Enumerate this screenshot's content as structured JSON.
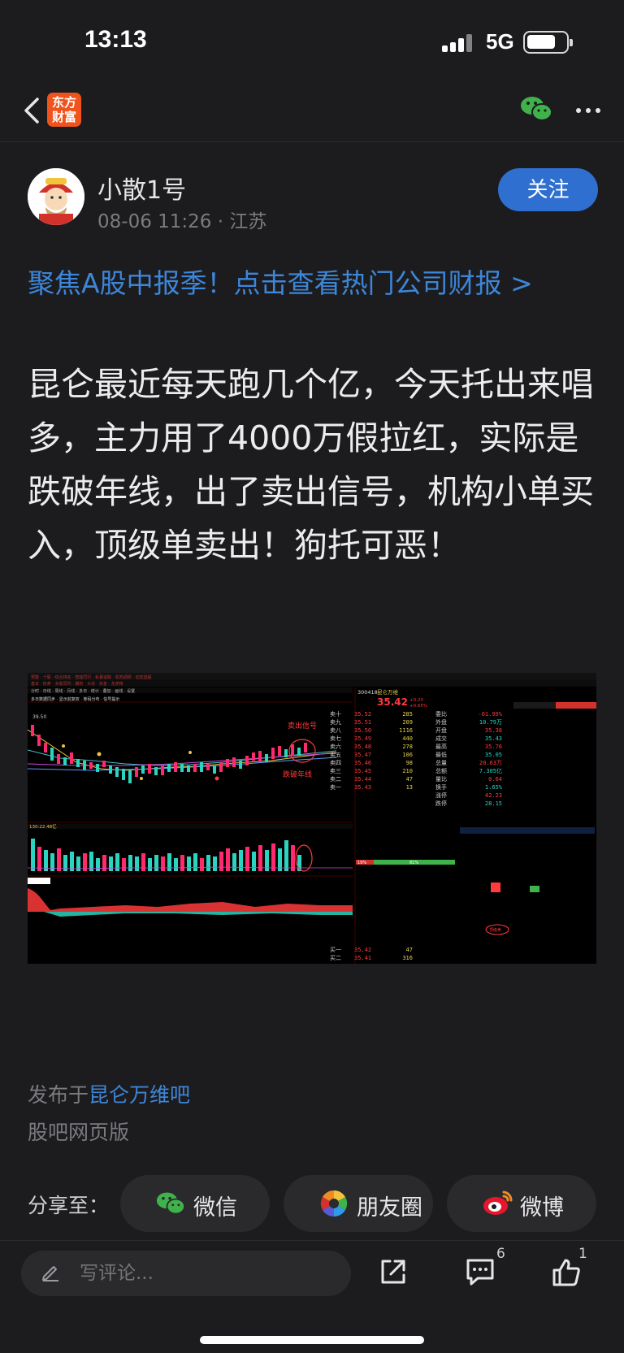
{
  "status": {
    "time": "13:13",
    "network": "5G"
  },
  "nav": {
    "logo_line1": "东方",
    "logo_line2": "财富"
  },
  "author": {
    "name": "小散1号",
    "meta": "08-06 11:26 · 江苏",
    "follow_label": "关注"
  },
  "promo": {
    "text": "聚焦A股中报季！点击查看热门公司财报 >"
  },
  "post": {
    "body": "昆仑最近每天跑几个亿，今天托出来唱多，主力用了4000万假拉红，实际是跌破年线，出了卖出信号，机构小单买入，顶级单卖出！狗托可恶！"
  },
  "stock_image": {
    "code": "300418",
    "name": "昆仑万维",
    "price": "35.42",
    "change": "+0.23",
    "change_pct": "+0.65%",
    "top_price": "39.50",
    "annotation_sell": "卖出信号",
    "annotation_break": "跌破年线",
    "vol_label": "130:22.48亿",
    "signal_tag": "顶级卖",
    "orderbook": [
      {
        "label": "卖十",
        "price": "35.52",
        "vol": "285"
      },
      {
        "label": "卖九",
        "price": "35.51",
        "vol": "209"
      },
      {
        "label": "卖八",
        "price": "35.50",
        "vol": "1116"
      },
      {
        "label": "卖七",
        "price": "35.49",
        "vol": "440"
      },
      {
        "label": "卖六",
        "price": "35.48",
        "vol": "278"
      },
      {
        "label": "卖五",
        "price": "35.47",
        "vol": "106"
      },
      {
        "label": "卖四",
        "price": "35.46",
        "vol": "98"
      },
      {
        "label": "卖三",
        "price": "35.45",
        "vol": "210"
      },
      {
        "label": "卖二",
        "price": "35.44",
        "vol": "47"
      },
      {
        "label": "卖一",
        "price": "35.43",
        "vol": "13"
      }
    ],
    "buy_rows": [
      {
        "label": "买一",
        "price": "35.42",
        "vol": "47"
      },
      {
        "label": "买二",
        "price": "35.41",
        "vol": "316"
      }
    ],
    "stats": [
      {
        "k": "委比",
        "v": "-61.99%"
      },
      {
        "k": "外盘",
        "v": "10.79万"
      },
      {
        "k": "开盘",
        "v": "35.38"
      },
      {
        "k": "成交",
        "v": "35.43"
      },
      {
        "k": "最高",
        "v": "35.76"
      },
      {
        "k": "最低",
        "v": "35.05"
      },
      {
        "k": "总量",
        "v": "20.63万"
      },
      {
        "k": "总额",
        "v": "7.305亿"
      },
      {
        "k": "量比",
        "v": "0.64"
      },
      {
        "k": "换手",
        "v": "1.65%"
      },
      {
        "k": "涨停",
        "v": "42.23"
      },
      {
        "k": "跌停",
        "v": "28.15"
      }
    ],
    "pct_left": "19%",
    "pct_right": "81%"
  },
  "footer": {
    "published_prefix": "发布于",
    "bar_name": "昆仑万维吧",
    "web_version": "股吧网页版",
    "share_label": "分享至：",
    "share_wechat": "微信",
    "share_moments": "朋友圈",
    "share_weibo": "微博"
  },
  "bottom_bar": {
    "comment_placeholder": "写评论...",
    "comment_count": "6",
    "like_count": "1"
  },
  "colors": {
    "accent": "#3d86d8",
    "follow": "#2f6fd0",
    "rise": "#ff2a6d",
    "fall": "#2bd4c0"
  }
}
